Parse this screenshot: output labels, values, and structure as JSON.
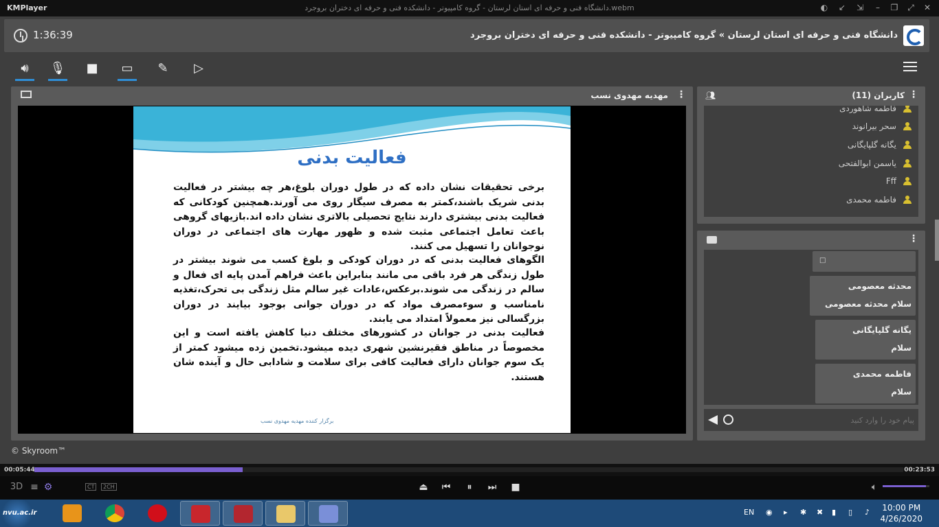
{
  "player": {
    "app_name": "KMPlayer",
    "file_title": "دانشگاه فنی و حرفه ای استان لرستان - گروه کامپیوتر - دانشکده فنی و حرفه ای دختران بروجرد.webm",
    "elapsed": "00:05:44",
    "total": "00:23:53",
    "progress": 0.24,
    "volume": 0.92,
    "labels": {
      "three_d": "3D",
      "ct": "CT",
      "ch": "2CH"
    }
  },
  "room": {
    "timer": "1:36:39",
    "title": "دانشگاه فنی و حرفه ای استان لرستان » گروه کامپیوتر - دانشکده فنی و حرفه ای دختران بروجرد"
  },
  "toolbar": {
    "icons": [
      "speaker-icon",
      "microphone-icon",
      "camera-icon",
      "screen-share-icon",
      "brush-icon",
      "presentation-icon"
    ]
  },
  "video": {
    "presenter": "مهدیه مهدوی نسب",
    "slide": {
      "heading": "فعالیت بدنی",
      "paragraphs": [
        "برخی تحقیقات نشان داده که در طول دوران بلوغ،هر چه بیشتر در فعالیت بدنی شریک باشند،کمتر به مصرف سیگار روی می آورند.همچنین کودکانی که فعالیت بدنی بیشتری دارند نتایج تحصیلی بالاتری نشان داده اند.بازیهای گروهی باعث تعامل اجتماعی مثبت شده و ظهور مهارت های اجتماعی در دوران نوجوانان را تسهیل می کنند.",
        "الگوهای فعالیت بدنی که در دوران کودکی و بلوغ کسب می شوند بیشتر در طول زندگی هر فرد باقی می مانند بنابراین باعث فراهم آمدن پایه ای فعال و سالم در زندگی می شوند.برعکس،عادات غیر سالم مثل زندگی بی تحرک،تغذیه نامناسب و سوءمصرف مواد که در دوران جوانی بوجود بیایند در دوران بزرگسالی نیز معمولاً امتداد می یابند.",
        "فعالیت بدنی در جوانان در کشورهای مختلف دنیا کاهش یافته است و این مخصوصاً در مناطق فقیرنشین شهری دیده میشود.تخمین زده میشود کمتر از یک سوم جوانان دارای فعالیت کافی برای سلامت و شادابی حال و آینده شان هستند."
      ],
      "footer": "برگزار کننده مهدیه مهدوی نسب"
    }
  },
  "branding": {
    "skyroom": "© Skyroom™"
  },
  "users": {
    "title": "کاربران (11)",
    "list": [
      {
        "name": "فاطمه شاهوردی"
      },
      {
        "name": "سحر بیرانوند"
      },
      {
        "name": "یگانه گلپایگانی"
      },
      {
        "name": "یاسمن ابوالفتحی"
      },
      {
        "name": "Fff"
      },
      {
        "name": "فاطمه محمدی"
      }
    ]
  },
  "chat": {
    "messages": [
      {
        "sender": "",
        "text": "□"
      },
      {
        "sender": "محدثه معصومی",
        "text": "سلام محدثه معصومی"
      },
      {
        "sender": "یگانه گلپایگانی",
        "text": "سلام"
      },
      {
        "sender": "فاطمه محمدی",
        "text": "سلام"
      }
    ],
    "input_placeholder": "پیام خود را وارد کنید"
  },
  "taskbar": {
    "start_label": "nvu.ac.ir",
    "apps": [
      "media-player",
      "chrome",
      "opera",
      "pdf-reader",
      "access",
      "file-explorer",
      "kmplayer"
    ],
    "language": "EN",
    "time": "10:00 PM",
    "date": "4/26/2020"
  },
  "colors": {
    "accent": "#2f8fd8",
    "progress": "#7a5fd0",
    "user_icon": "#d9c030",
    "slide_heading": "#2e6fc4"
  }
}
